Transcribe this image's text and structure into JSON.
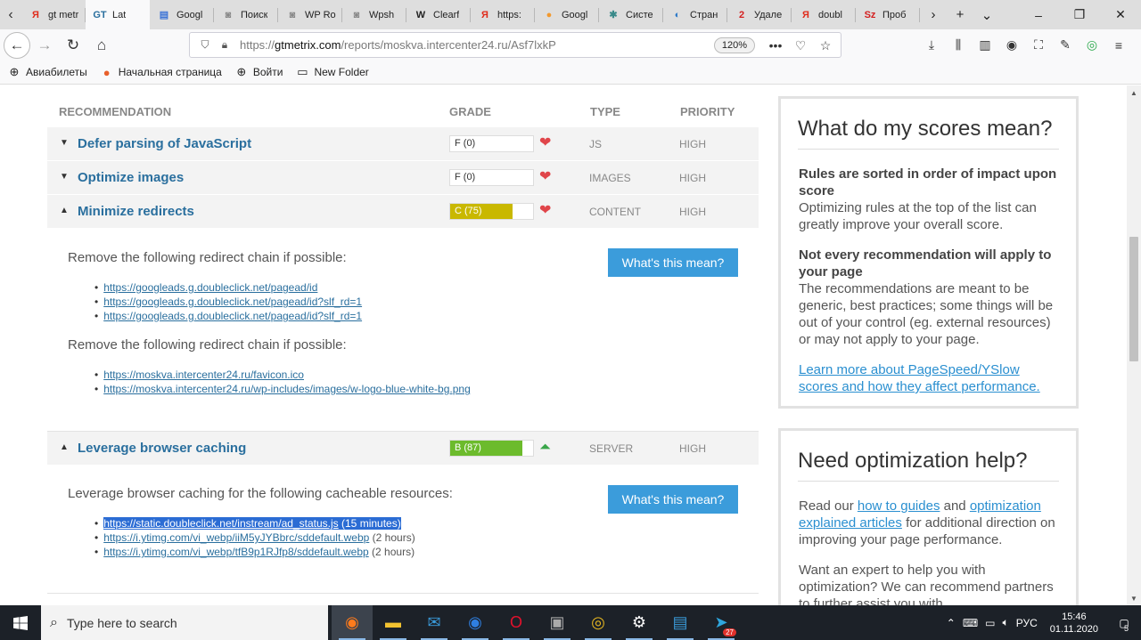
{
  "browser": {
    "tabs": [
      {
        "icon": "yandex-icon",
        "glyph": "Я",
        "color": "#e02b1b",
        "label": "gt metr"
      },
      {
        "icon": "gtmetrix-icon",
        "glyph": "GT",
        "color": "#2a6f9e",
        "label": "Lat",
        "active": true
      },
      {
        "icon": "google-docs-icon",
        "glyph": "▤",
        "color": "#3b73d6",
        "label": "Googl"
      },
      {
        "icon": "generic-page-icon",
        "glyph": "◙",
        "color": "#888",
        "label": "Поиск"
      },
      {
        "icon": "generic-page-icon",
        "glyph": "◙",
        "color": "#888",
        "label": "WP Ro"
      },
      {
        "icon": "generic-page-icon",
        "glyph": "◙",
        "color": "#888",
        "label": "Wpsh"
      },
      {
        "icon": "wordpress-icon",
        "glyph": "W",
        "color": "#222",
        "label": "Clearf"
      },
      {
        "icon": "yandex-icon",
        "glyph": "Я",
        "color": "#e02b1b",
        "label": "https:"
      },
      {
        "icon": "google-photos-icon",
        "glyph": "●",
        "color": "#f2992e",
        "label": "Googl"
      },
      {
        "icon": "system-icon",
        "glyph": "✱",
        "color": "#3a8a8a",
        "label": "Систе"
      },
      {
        "icon": "browser-icon",
        "glyph": "◐",
        "color": "#2a78c8",
        "label": "Стран"
      },
      {
        "icon": "number2-icon",
        "glyph": "2",
        "color": "#d42020",
        "label": "Удале"
      },
      {
        "icon": "yandex-icon",
        "glyph": "Я",
        "color": "#e02b1b",
        "label": "doubl"
      },
      {
        "icon": "sz-icon",
        "glyph": "Sz",
        "color": "#d42020",
        "label": "Проб"
      }
    ],
    "url_prefix": "https://",
    "url_domain": "gtmetrix.com",
    "url_path": "/reports/moskva.intercenter24.ru/Asf7lxkP",
    "zoom": "120%",
    "bookmarks": [
      {
        "icon": "globe-icon",
        "label": "Авиабилеты"
      },
      {
        "icon": "firefox-home-icon",
        "label": "Начальная страница"
      },
      {
        "icon": "globe-icon",
        "label": "Войти"
      },
      {
        "icon": "folder-icon",
        "label": "New Folder"
      }
    ]
  },
  "table": {
    "headers": {
      "recommendation": "RECOMMENDATION",
      "grade": "GRADE",
      "type": "TYPE",
      "priority": "PRIORITY"
    },
    "rows": [
      {
        "title": "Defer parsing of JavaScript",
        "grade": "F (0)",
        "score": 0,
        "grade_color": "#d9534f",
        "trend": "down",
        "type": "JS",
        "priority": "HIGH",
        "expanded": false
      },
      {
        "title": "Optimize images",
        "grade": "F (0)",
        "score": 0,
        "grade_color": "#d9534f",
        "trend": "down",
        "type": "IMAGES",
        "priority": "HIGH",
        "expanded": false
      },
      {
        "title": "Minimize redirects",
        "grade": "C (75)",
        "score": 75,
        "grade_color": "#c9b800",
        "trend": "down",
        "type": "CONTENT",
        "priority": "HIGH",
        "expanded": true
      },
      {
        "title": "Leverage browser caching",
        "grade": "B (87)",
        "score": 87,
        "grade_color": "#6cbb2c",
        "trend": "up",
        "type": "SERVER",
        "priority": "HIGH",
        "expanded": true
      }
    ]
  },
  "redirects": {
    "chain1_intro": "Remove the following redirect chain if possible:",
    "chain1": [
      "https://googleads.g.doubleclick.net/pagead/id",
      "https://googleads.g.doubleclick.net/pagead/id?slf_rd=1",
      "https://googleads.g.doubleclick.net/pagead/id?slf_rd=1"
    ],
    "chain2_intro": "Remove the following redirect chain if possible:",
    "chain2": [
      "https://moskva.intercenter24.ru/favicon.ico",
      "https://moskva.intercenter24.ru/wp-includes/images/w-logo-blue-white-bg.png"
    ],
    "button": "What's this mean?"
  },
  "caching": {
    "intro": "Leverage browser caching for the following cacheable resources:",
    "items": [
      {
        "url": "https://static.doubleclick.net/instream/ad_status.js",
        "duration": "(15 minutes)",
        "selected": true
      },
      {
        "url": "https://i.ytimg.com/vi_webp/iiM5yJYBbrc/sddefault.webp",
        "duration": "(2 hours)"
      },
      {
        "url": "https://i.ytimg.com/vi_webp/tfB9p1RJfp8/sddefault.webp",
        "duration": "(2 hours)"
      }
    ],
    "button": "What's this mean?"
  },
  "sidebar": {
    "scores": {
      "title": "What do my scores mean?",
      "h1": "Rules are sorted in order of impact upon score",
      "p1": "Optimizing rules at the top of the list can greatly improve your overall score.",
      "h2": "Not every recommendation will apply to your page",
      "p2": "The recommendations are meant to be generic, best practices; some things will be out of your control (eg. external resources) or may not apply to your page.",
      "link": "Learn more about PageSpeed/YSlow scores and how they affect performance."
    },
    "help": {
      "title": "Need optimization help?",
      "t1": "Read our ",
      "l1": "how to guides",
      "t2": " and ",
      "l2": "optimization explained articles",
      "t3": " for additional direction on improving your page performance.",
      "p2": "Want an expert to help you with optimization? We can recommend partners to further assist you with"
    }
  },
  "taskbar": {
    "search_placeholder": "Type here to search",
    "apps": [
      {
        "icon": "firefox-icon",
        "glyph": "◉",
        "color": "#ff7b1c",
        "active": true
      },
      {
        "icon": "file-explorer-icon",
        "glyph": "▬",
        "color": "#f2c230"
      },
      {
        "icon": "mail-icon",
        "glyph": "✉",
        "color": "#3a9ad9"
      },
      {
        "icon": "firefox-dev-icon",
        "glyph": "◉",
        "color": "#2f7fe0"
      },
      {
        "icon": "opera-icon",
        "glyph": "O",
        "color": "#e3112c"
      },
      {
        "icon": "scanner-icon",
        "glyph": "▣",
        "color": "#aaaaaa"
      },
      {
        "icon": "chrome-icon",
        "glyph": "◎",
        "color": "#e8b820"
      },
      {
        "icon": "settings-icon",
        "glyph": "⚙",
        "color": "#ffffff"
      },
      {
        "icon": "remote-desktop-icon",
        "glyph": "▤",
        "color": "#3a9ad9"
      },
      {
        "icon": "telegram-icon",
        "glyph": "➤",
        "color": "#2ea6de",
        "badge": "27"
      }
    ],
    "lang": "РУС",
    "time": "15:46",
    "date": "01.11.2020",
    "notif": "5"
  }
}
